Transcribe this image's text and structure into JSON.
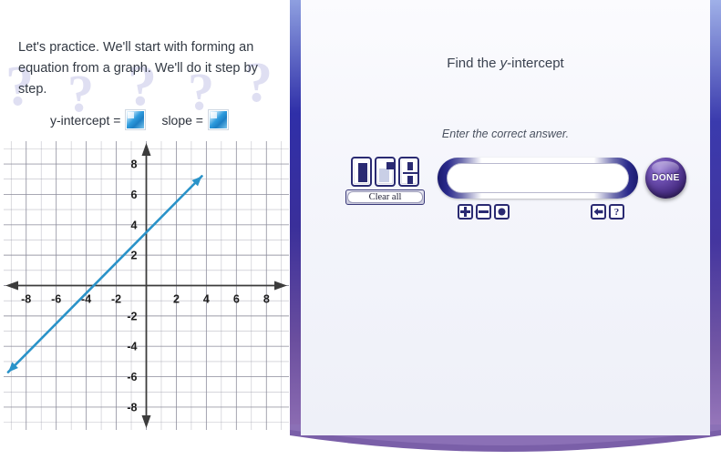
{
  "left": {
    "lesson_text": "Let's practice. We'll start with forming an equation from a graph. We'll do it step by step.",
    "yintercept_label": "y-intercept =",
    "slope_label": "slope =",
    "thumb_icon": "image-placeholder-icon",
    "watermarks": [
      "?",
      "?",
      "?",
      "?",
      "?",
      "?"
    ]
  },
  "right": {
    "title_prefix": "Find the ",
    "title_italic": "y",
    "title_suffix": "-intercept",
    "instruction": "Enter the correct answer.",
    "answer_value": "",
    "answer_placeholder": "",
    "clear_all_label": "Clear all",
    "done_label": "DONE",
    "templates": [
      {
        "name": "plain-box-template",
        "glyph": "box"
      },
      {
        "name": "exponent-template",
        "glyph": "superscript"
      },
      {
        "name": "fraction-template",
        "glyph": "fraction"
      }
    ],
    "operators": [
      {
        "name": "plus-button",
        "glyph": "+"
      },
      {
        "name": "minus-button",
        "glyph": "−"
      },
      {
        "name": "decimal-point-button",
        "glyph": "●"
      }
    ],
    "nav_buttons": [
      {
        "name": "backspace-button",
        "glyph": "←"
      },
      {
        "name": "help-button",
        "glyph": "?"
      }
    ]
  },
  "colors": {
    "line": "#2a93c9",
    "frame_top": "#2f2fa8",
    "frame_bottom": "#8f6fb4",
    "palette_border": "#2a2a72",
    "done_purple": "#4a2f86",
    "axis": "#3c3c3c",
    "grid": "#8a8a9a"
  },
  "chart_data": {
    "type": "line",
    "title": "",
    "xlabel": "",
    "ylabel": "",
    "xlim": [
      -9.5,
      9.5
    ],
    "ylim": [
      -9.5,
      9.5
    ],
    "grid": true,
    "x_ticks": [
      -8,
      -6,
      -4,
      -2,
      2,
      4,
      6,
      8
    ],
    "y_ticks": [
      8,
      6,
      4,
      2,
      -2,
      -4,
      -6,
      -8
    ],
    "x_tick_labels": [
      "-8",
      "-6",
      "-4",
      "-2",
      "2",
      "4",
      "6",
      "8"
    ],
    "y_tick_labels": [
      "8",
      "6",
      "4",
      "2",
      "-2",
      "-4",
      "-6",
      "-8"
    ],
    "series": [
      {
        "name": "line",
        "slope": 1,
        "y_intercept": 3.5,
        "x_intercept": -3.5,
        "points": [
          [
            -9.2,
            -5.7
          ],
          [
            3.7,
            7.2
          ]
        ],
        "color": "#2a93c9",
        "arrows": "both"
      }
    ]
  }
}
